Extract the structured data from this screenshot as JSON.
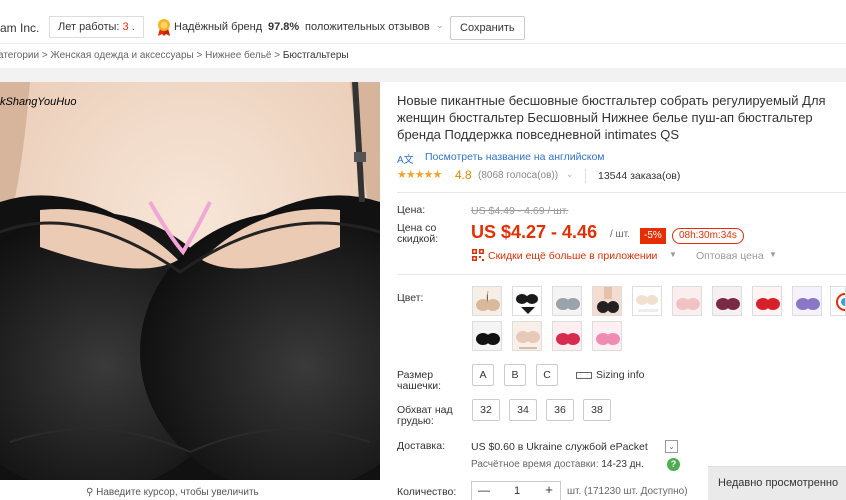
{
  "store": {
    "name": "am Inc.",
    "years_label": "Лет работы: ",
    "years_value": "3",
    "years_suffix": " .",
    "brand_label": "Надёжный бренд",
    "feedback_percent": "97.8%",
    "feedback_label": "положительных отзывов",
    "save_label": "Сохранить"
  },
  "breadcrumb": {
    "items": [
      "атегории",
      "Женская одежда и аксессуары",
      "Нижнее бельё"
    ],
    "separator": " > ",
    "current": "Бюстгальтеры"
  },
  "image": {
    "watermark": "kShangYouHuo",
    "zoom_hint": "Наведите курсор, чтобы увеличить"
  },
  "product": {
    "title": "Новые пикантные бесшовные бюстгальтер собрать регулируемый Для женщин бюстгальтер Бесшовный Нижнее белье пуш-ап бюстгальтер бренда Поддержка повседневной intimates QS",
    "translate_icon": "A文",
    "translate_link": "Посмотреть название на английском",
    "stars": "★★★★★",
    "rating": "4.8",
    "votes": "(8068 голоса(ов))",
    "orders": "13544 заказа(ов)"
  },
  "price": {
    "label": "Цена:",
    "old": "US $4.49 - 4.69 / шт.",
    "discount_label_line1": "Цена со",
    "discount_label_line2": "скидкой:",
    "current": "US $4.27 - 4.46",
    "per_unit": "/ шт.",
    "discount": "-5%",
    "timer": "08h:30m:34s",
    "app_offer": "Скидки ещё больше в приложении",
    "wholesale": "Оптовая цена"
  },
  "color": {
    "label": "Цвет:",
    "swatches": [
      "beige",
      "black-set",
      "grey",
      "nude-photo",
      "white-set",
      "light-pink",
      "wine",
      "red",
      "purple",
      "multi",
      "black",
      "nude",
      "rose-red",
      "pink"
    ]
  },
  "cup_size": {
    "label_line1": "Размер",
    "label_line2": "чашечки:",
    "options": [
      "A",
      "B",
      "C"
    ],
    "sizing_info": "Sizing info"
  },
  "band_size": {
    "label_line1": "Обхват над",
    "label_line2": "грудью:",
    "options": [
      "32",
      "34",
      "36",
      "38"
    ]
  },
  "shipping": {
    "label": "Доставка:",
    "price_text": "US $0.60 в Ukraine службой ePacket",
    "eta_label": "Расчётное время доставки:",
    "eta_value": "14-23 дн."
  },
  "quantity": {
    "label": "Количество:",
    "minus": "—",
    "value": "1",
    "plus": "+",
    "stock": "шт. (171230 шт. Доступно)"
  },
  "recently_viewed": "Недавно просмотренно",
  "colors": {
    "accent": "#e62e04",
    "link": "#2e72d2",
    "star": "#f3a32b"
  }
}
